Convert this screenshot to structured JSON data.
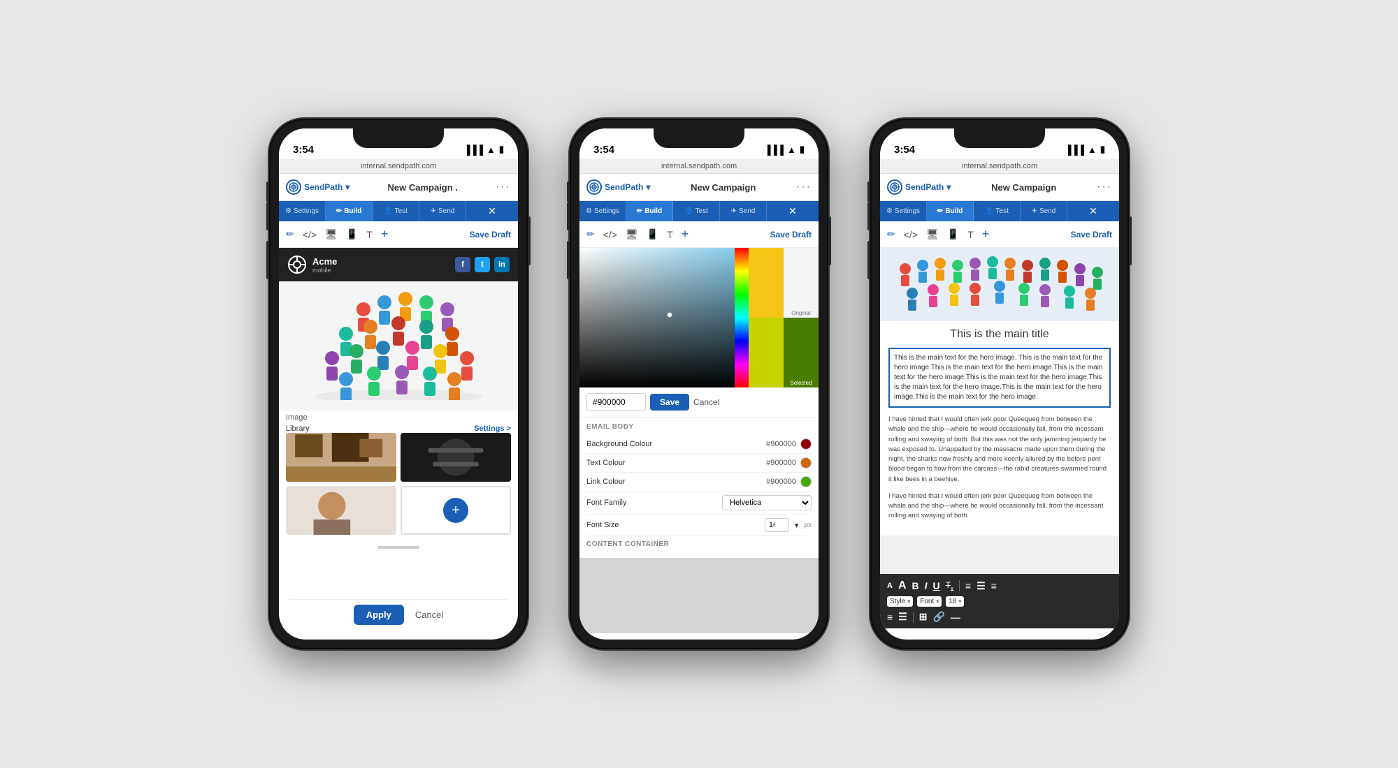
{
  "page": {
    "background": "#e8e8e8"
  },
  "phones": [
    {
      "id": "phone1",
      "time": "3:54",
      "url": "internal.sendpath.com",
      "appName": "SendPath",
      "campaignTitle": "New Campaign .",
      "tabs": [
        {
          "label": "Settings",
          "icon": "⚙",
          "active": false
        },
        {
          "label": "Build",
          "icon": "✏",
          "active": true
        },
        {
          "label": "Test",
          "icon": "👤",
          "active": false
        },
        {
          "label": "Send",
          "icon": "✈",
          "active": false
        }
      ],
      "toolbar": {
        "saveDraft": "Save Draft"
      },
      "content": "image_library",
      "imageLabel": "Image",
      "libraryLabel": "Library",
      "settingsLink": "Settings >",
      "applyBtn": "Apply",
      "cancelBtn": "Cancel"
    },
    {
      "id": "phone2",
      "time": "3:54",
      "url": "internal.sendpath.com",
      "appName": "SendPath",
      "campaignTitle": "New Campaign",
      "tabs": [
        {
          "label": "Settings",
          "icon": "⚙",
          "active": false
        },
        {
          "label": "Build",
          "icon": "✏",
          "active": true
        },
        {
          "label": "Test",
          "icon": "👤",
          "active": false
        },
        {
          "label": "Send",
          "icon": "✈",
          "active": false
        }
      ],
      "toolbar": {
        "saveDraft": "Save Draft"
      },
      "content": "color_picker",
      "hexValue": "#900000",
      "saveBtn": "Save",
      "cancelBtn": "Cancel",
      "emailBodyTitle": "EMAIL BODY",
      "settings": [
        {
          "label": "Background Colour",
          "value": "#900000",
          "colorDot": "#900000"
        },
        {
          "label": "Text Colour",
          "value": "#900000",
          "colorDot": "#cc6600"
        },
        {
          "label": "Link Colour",
          "value": "#900000",
          "colorDot": "#44aa00"
        },
        {
          "label": "Font Family",
          "value": "Helvetica",
          "type": "select"
        },
        {
          "label": "Font Size",
          "value": "16",
          "type": "number",
          "suffix": "px"
        }
      ],
      "contentContainerLabel": "CONTENT CONTAINER"
    },
    {
      "id": "phone3",
      "time": "3:54",
      "url": "internal.sendpath.com",
      "appName": "SendPath",
      "campaignTitle": "New Campaign",
      "tabs": [
        {
          "label": "Settings",
          "icon": "⚙",
          "active": false
        },
        {
          "label": "Build",
          "icon": "✏",
          "active": true
        },
        {
          "label": "Test",
          "icon": "👤",
          "active": false
        },
        {
          "label": "Send",
          "icon": "✈",
          "active": false
        }
      ],
      "toolbar": {
        "saveDraft": "Save Draft"
      },
      "content": "text_editor",
      "mainTitle": "This is the main title",
      "heroText": "This is the main text for the hero image. This is the main text for the hero image.This is the main text for the hero image.This is the main text for the hero image.This is the main text for the hero image.This is the main text for the hero image.This is the main text for the hero image.This is the main text for the hero image.",
      "bodyText1": "I have hinted that I would often jerk poor Queequeg from between the whale and the ship—where he would occasionally fall, from the incessant rolling and swaying of both. But this was not the only jamming jeopardy he was exposed to. Unappalled by the massacre made upon them during the night, the sharks now freshly and more keenly allured by the before pent blood began to flow from the carcass—the rabid creatures swarmed round it like bees in a beehive.",
      "bodyText2": "I have hinted that I would often jerk poor Queequeg from between the whale and the ship—where he would occasionally fall, from the incessant rolling and swaying of both.",
      "rteTools": {
        "styleLabel": "Style",
        "fontLabel": "Font",
        "sizeLabel": "18"
      }
    }
  ]
}
